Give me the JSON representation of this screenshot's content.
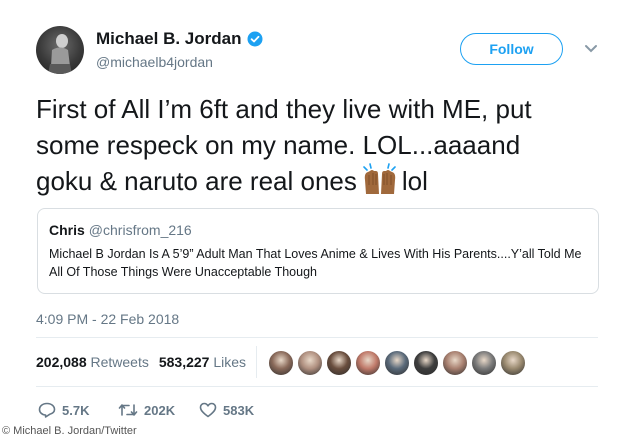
{
  "author": {
    "name": "Michael B. Jordan",
    "handle": "@michaelb4jordan",
    "verified_icon": "verified-badge-icon"
  },
  "follow_label": "Follow",
  "tweet": {
    "line1": "First of All I’m 6ft and they live with ME, put",
    "line2": "some respeck on my name. LOL...aaaand",
    "line3_before": "goku & naruto are real ones",
    "line3_after": "lol",
    "emoji": "raising-hands-icon"
  },
  "quote": {
    "name": "Chris",
    "handle": "@chrisfrom_216",
    "text": "Michael B Jordan Is A 5’9” Adult Man That Loves Anime & Lives With His Parents....Y’all Told Me All Of Those Things Were Unacceptable Though"
  },
  "timestamp": "4:09 PM - 22 Feb 2018",
  "stats": {
    "retweets_count": "202,088",
    "retweets_label": "Retweets",
    "likes_count": "583,227",
    "likes_label": "Likes"
  },
  "likers_count": 9,
  "actions": {
    "replies": "5.7K",
    "retweets": "202K",
    "likes": "583K"
  },
  "credit": "© Michael B. Jordan/Twitter",
  "colors": {
    "accent": "#1da1f2",
    "secondary_text": "#657786",
    "primary_text": "#14171a",
    "emoji_skin": "#a0693c"
  }
}
